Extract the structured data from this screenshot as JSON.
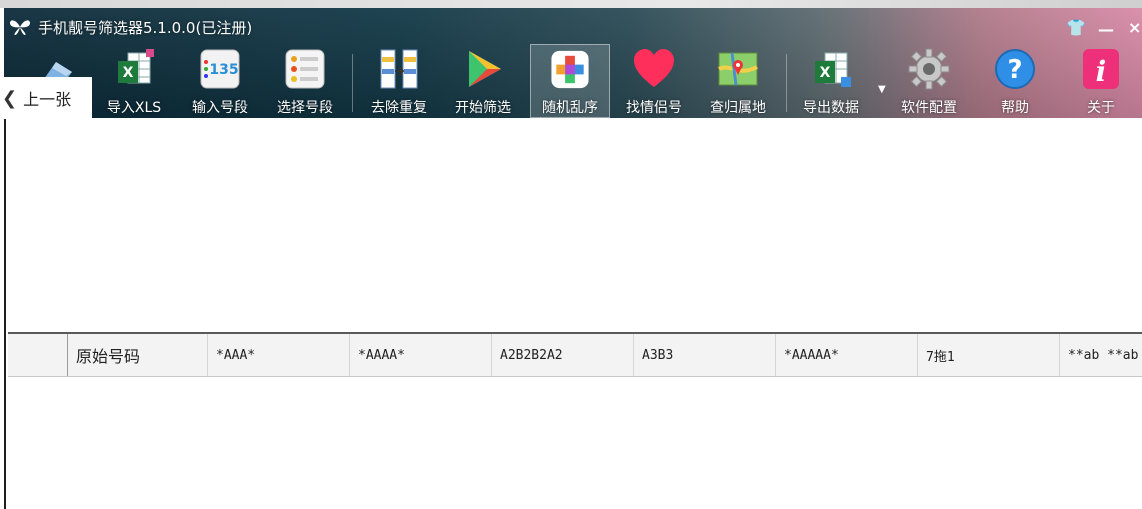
{
  "window": {
    "title": "手机靓号筛选器5.1.0.0(已注册)"
  },
  "toolbar": {
    "items": [
      {
        "label": "导入XLS",
        "icon": "excel-import-icon"
      },
      {
        "label": "输入号段",
        "icon": "number-input-icon"
      },
      {
        "label": "选择号段",
        "icon": "list-select-icon"
      },
      {
        "label": "去除重复",
        "icon": "dedupe-icon"
      },
      {
        "label": "开始筛选",
        "icon": "play-icon"
      },
      {
        "label": "随机乱序",
        "icon": "shuffle-icon"
      },
      {
        "label": "找情侣号",
        "icon": "heart-icon"
      },
      {
        "label": "查归属地",
        "icon": "map-icon"
      },
      {
        "label": "导出数据",
        "icon": "excel-export-icon"
      },
      {
        "label": "软件配置",
        "icon": "gear-icon"
      },
      {
        "label": "帮助",
        "icon": "help-icon"
      },
      {
        "label": "关于",
        "icon": "info-icon"
      }
    ],
    "active": "随机乱序"
  },
  "prev_button": {
    "label": "上一张"
  },
  "grid": {
    "columns": [
      "原始号码",
      "*AAA*",
      "*AAAA*",
      "A2B2B2A2",
      "A3B3",
      "*AAAAA*",
      "7拖1",
      "**ab **ab"
    ]
  },
  "colors": {
    "title_bar_start": "#0c2a39",
    "title_bar_end": "#d88aa6",
    "header_bg": "#f3f3f3"
  }
}
